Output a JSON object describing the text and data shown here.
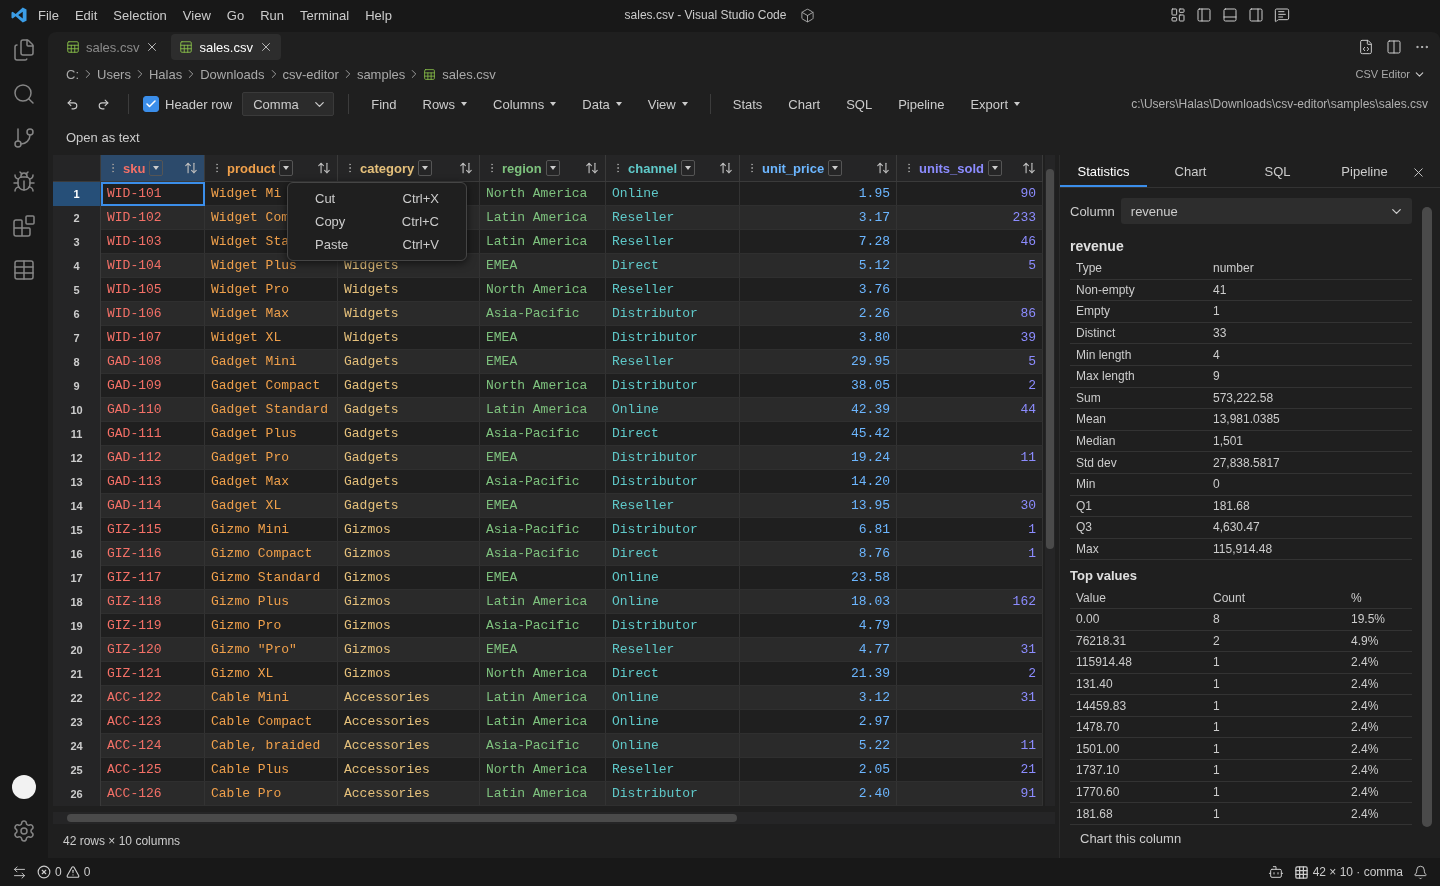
{
  "title_bar": {
    "menus": [
      "File",
      "Edit",
      "Selection",
      "View",
      "Go",
      "Run",
      "Terminal",
      "Help"
    ],
    "title": "sales.csv - Visual Studio Code"
  },
  "tabs": [
    {
      "label": "sales.csv",
      "selected": false
    },
    {
      "label": "sales.csv",
      "selected": true
    }
  ],
  "breadcrumbs": [
    "C:",
    "Users",
    "Halas",
    "Downloads",
    "csv-editor",
    "samples",
    "sales.csv"
  ],
  "editor_mode": "CSV Editor",
  "toolbar": {
    "header_row": {
      "label": "Header row",
      "checked": true
    },
    "delimiter": "Comma",
    "groups": [
      [
        {
          "label": "Find",
          "dropdown": false
        },
        {
          "label": "Rows",
          "dropdown": true
        },
        {
          "label": "Columns",
          "dropdown": true
        },
        {
          "label": "Data",
          "dropdown": true
        },
        {
          "label": "View",
          "dropdown": true
        }
      ],
      [
        {
          "label": "Stats",
          "dropdown": false
        },
        {
          "label": "Chart",
          "dropdown": false
        },
        {
          "label": "SQL",
          "dropdown": false
        },
        {
          "label": "Pipeline",
          "dropdown": false
        },
        {
          "label": "Export",
          "dropdown": true
        }
      ]
    ],
    "path": "c:\\Users\\Halas\\Downloads\\csv-editor\\samples\\sales.csv"
  },
  "open_as_text": "Open as text",
  "grid": {
    "columns": [
      {
        "name": "sku",
        "color": "#f47067",
        "selected": true,
        "kind": "text"
      },
      {
        "name": "product",
        "color": "#f0a04b",
        "selected": false,
        "kind": "text"
      },
      {
        "name": "category",
        "color": "#e5c07b",
        "selected": false,
        "kind": "text"
      },
      {
        "name": "region",
        "color": "#7ec27e",
        "selected": false,
        "kind": "text"
      },
      {
        "name": "channel",
        "color": "#5fc9c9",
        "selected": false,
        "kind": "text"
      },
      {
        "name": "unit_price",
        "color": "#6cb6ff",
        "selected": false,
        "kind": "number"
      },
      {
        "name": "units_sold",
        "color": "#8c8cff",
        "selected": false,
        "kind": "number"
      }
    ],
    "rows": [
      {
        "number": "1",
        "selected": true,
        "cells": [
          "WID-101",
          "Widget Mi",
          null,
          "North America",
          "Online",
          "1.95",
          "90"
        ]
      },
      {
        "number": "2",
        "selected": false,
        "cells": [
          "WID-102",
          "Widget Com",
          null,
          "Latin America",
          "Reseller",
          "3.17",
          "233"
        ]
      },
      {
        "number": "3",
        "selected": false,
        "cells": [
          "WID-103",
          "Widget Sta",
          null,
          "Latin America",
          "Reseller",
          "7.28",
          "46"
        ]
      },
      {
        "number": "4",
        "selected": false,
        "cells": [
          "WID-104",
          "Widget Plus",
          "Widgets",
          "EMEA",
          "Direct",
          "5.12",
          "5"
        ]
      },
      {
        "number": "5",
        "selected": false,
        "cells": [
          "WID-105",
          "Widget Pro",
          "Widgets",
          "North America",
          "Reseller",
          "3.76",
          null
        ]
      },
      {
        "number": "6",
        "selected": false,
        "cells": [
          "WID-106",
          "Widget Max",
          "Widgets",
          "Asia-Pacific",
          "Distributor",
          "2.26",
          "86"
        ]
      },
      {
        "number": "7",
        "selected": false,
        "cells": [
          "WID-107",
          "Widget XL",
          "Widgets",
          "EMEA",
          "Distributor",
          "3.80",
          "39"
        ]
      },
      {
        "number": "8",
        "selected": false,
        "cells": [
          "GAD-108",
          "Gadget Mini",
          "Gadgets",
          "EMEA",
          "Reseller",
          "29.95",
          "5"
        ]
      },
      {
        "number": "9",
        "selected": false,
        "cells": [
          "GAD-109",
          "Gadget Compact",
          "Gadgets",
          "North America",
          "Distributor",
          "38.05",
          "2"
        ]
      },
      {
        "number": "10",
        "selected": false,
        "cells": [
          "GAD-110",
          "Gadget Standard",
          "Gadgets",
          "Latin America",
          "Online",
          "42.39",
          "44"
        ]
      },
      {
        "number": "11",
        "selected": false,
        "cells": [
          "GAD-111",
          "Gadget Plus",
          "Gadgets",
          "Asia-Pacific",
          "Direct",
          "45.42",
          null
        ]
      },
      {
        "number": "12",
        "selected": false,
        "cells": [
          "GAD-112",
          "Gadget Pro",
          "Gadgets",
          "EMEA",
          "Distributor",
          "19.24",
          "11"
        ]
      },
      {
        "number": "13",
        "selected": false,
        "cells": [
          "GAD-113",
          "Gadget Max",
          "Gadgets",
          "Asia-Pacific",
          "Distributor",
          "14.20",
          null
        ]
      },
      {
        "number": "14",
        "selected": false,
        "cells": [
          "GAD-114",
          "Gadget XL",
          "Gadgets",
          "EMEA",
          "Reseller",
          "13.95",
          "30"
        ]
      },
      {
        "number": "15",
        "selected": false,
        "cells": [
          "GIZ-115",
          "Gizmo Mini",
          "Gizmos",
          "Asia-Pacific",
          "Distributor",
          "6.81",
          "1"
        ]
      },
      {
        "number": "16",
        "selected": false,
        "cells": [
          "GIZ-116",
          "Gizmo Compact",
          "Gizmos",
          "Asia-Pacific",
          "Direct",
          "8.76",
          "1"
        ]
      },
      {
        "number": "17",
        "selected": false,
        "cells": [
          "GIZ-117",
          "Gizmo Standard",
          "Gizmos",
          "EMEA",
          "Online",
          "23.58",
          null
        ]
      },
      {
        "number": "18",
        "selected": false,
        "cells": [
          "GIZ-118",
          "Gizmo Plus",
          "Gizmos",
          "Latin America",
          "Online",
          "18.03",
          "162"
        ]
      },
      {
        "number": "19",
        "selected": false,
        "cells": [
          "GIZ-119",
          "Gizmo Pro",
          "Gizmos",
          "Asia-Pacific",
          "Distributor",
          "4.79",
          null
        ]
      },
      {
        "number": "20",
        "selected": false,
        "cells": [
          "GIZ-120",
          "Gizmo \"Pro\"",
          "Gizmos",
          "EMEA",
          "Reseller",
          "4.77",
          "31"
        ]
      },
      {
        "number": "21",
        "selected": false,
        "cells": [
          "GIZ-121",
          "Gizmo XL",
          "Gizmos",
          "North America",
          "Direct",
          "21.39",
          "2"
        ]
      },
      {
        "number": "22",
        "selected": false,
        "cells": [
          "ACC-122",
          "Cable Mini",
          "Accessories",
          "Latin America",
          "Online",
          "3.12",
          "31"
        ]
      },
      {
        "number": "23",
        "selected": false,
        "cells": [
          "ACC-123",
          "Cable Compact",
          "Accessories",
          "Latin America",
          "Online",
          "2.97",
          null
        ]
      },
      {
        "number": "24",
        "selected": false,
        "cells": [
          "ACC-124",
          "Cable, braided",
          "Accessories",
          "Asia-Pacific",
          "Online",
          "5.22",
          "11"
        ]
      },
      {
        "number": "25",
        "selected": false,
        "cells": [
          "ACC-125",
          "Cable Plus",
          "Accessories",
          "North America",
          "Reseller",
          "2.05",
          "21"
        ]
      },
      {
        "number": "26",
        "selected": false,
        "cells": [
          "ACC-126",
          "Cable Pro",
          "Accessories",
          "Latin America",
          "Distributor",
          "2.40",
          "91"
        ]
      }
    ],
    "context_menu": [
      {
        "label": "Cut",
        "shortcut": "Ctrl+X"
      },
      {
        "label": "Copy",
        "shortcut": "Ctrl+C"
      },
      {
        "label": "Paste",
        "shortcut": "Ctrl+V"
      }
    ]
  },
  "footer": "42 rows × 10 columns",
  "side_panel": {
    "tabs": [
      {
        "label": "Statistics",
        "selected": true
      },
      {
        "label": "Chart",
        "selected": false
      },
      {
        "label": "SQL",
        "selected": false
      },
      {
        "label": "Pipeline",
        "selected": false
      }
    ],
    "column_label": "Column",
    "column_value": "revenue",
    "heading": "revenue",
    "stats": [
      {
        "label": "Type",
        "value": "number"
      },
      {
        "label": "Non-empty",
        "value": "41"
      },
      {
        "label": "Empty",
        "value": "1"
      },
      {
        "label": "Distinct",
        "value": "33"
      },
      {
        "label": "Min length",
        "value": "4"
      },
      {
        "label": "Max length",
        "value": "9"
      },
      {
        "label": "Sum",
        "value": "573,222.58"
      },
      {
        "label": "Mean",
        "value": "13,981.0385"
      },
      {
        "label": "Median",
        "value": "1,501"
      },
      {
        "label": "Std dev",
        "value": "27,838.5817"
      },
      {
        "label": "Min",
        "value": "0"
      },
      {
        "label": "Q1",
        "value": "181.68"
      },
      {
        "label": "Q3",
        "value": "4,630.47"
      },
      {
        "label": "Max",
        "value": "115,914.48"
      }
    ],
    "top_values_heading": "Top values",
    "top_values_columns": [
      "Value",
      "Count",
      "%"
    ],
    "top_values": [
      [
        "0.00",
        "8",
        "19.5%"
      ],
      [
        "76218.31",
        "2",
        "4.9%"
      ],
      [
        "115914.48",
        "1",
        "2.4%"
      ],
      [
        "131.40",
        "1",
        "2.4%"
      ],
      [
        "14459.83",
        "1",
        "2.4%"
      ],
      [
        "1478.70",
        "1",
        "2.4%"
      ],
      [
        "1501.00",
        "1",
        "2.4%"
      ],
      [
        "1737.10",
        "1",
        "2.4%"
      ],
      [
        "1770.60",
        "1",
        "2.4%"
      ],
      [
        "181.68",
        "1",
        "2.4%"
      ]
    ],
    "chart_link": "Chart this column"
  },
  "status_bar": {
    "errors": "0",
    "warnings": "0",
    "grid_info": "42 × 10 · comma"
  }
}
